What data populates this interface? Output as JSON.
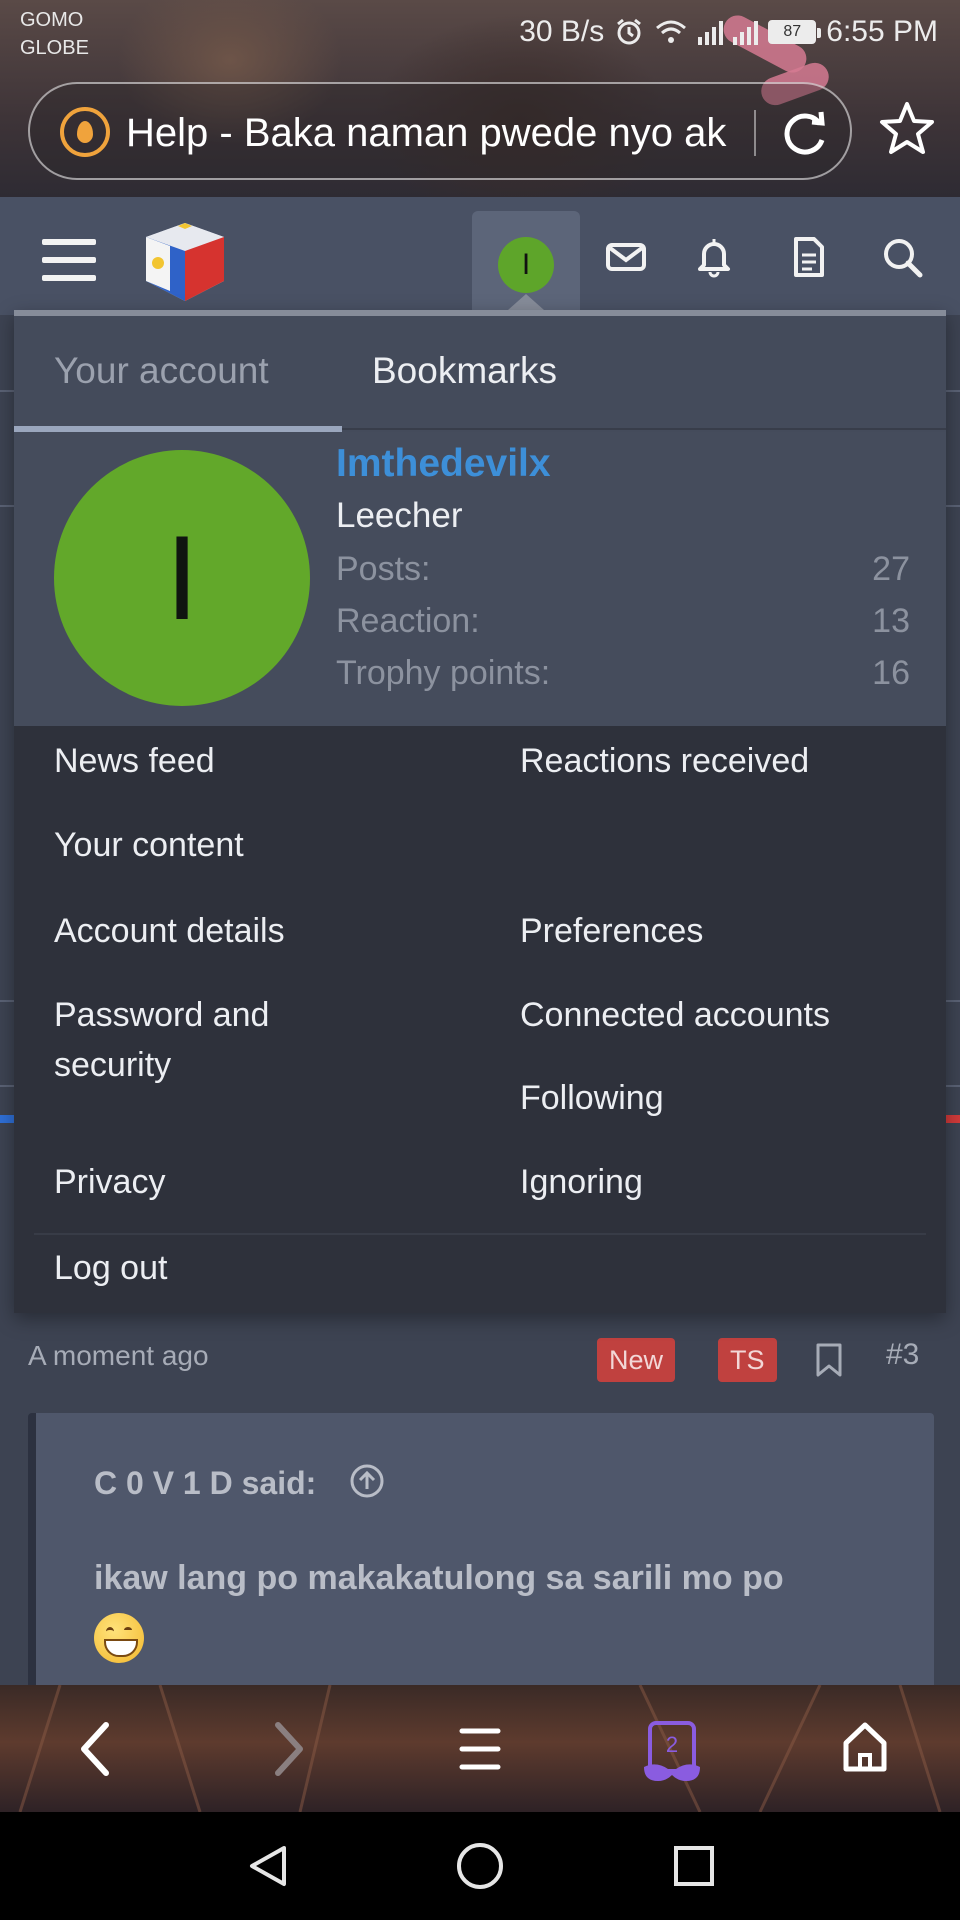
{
  "status_bar": {
    "carrier_line1": "GOMO",
    "carrier_line2": "GLOBE",
    "net_speed": "30 B/s",
    "battery": "87",
    "time": "6:55 PM"
  },
  "browser": {
    "url_text": "Help - Baka naman pwede nyo ak",
    "tab_count": "2"
  },
  "site_header": {
    "avatar_letter": "I"
  },
  "account_menu": {
    "tabs": [
      "Your account",
      "Bookmarks"
    ],
    "user": {
      "avatar_letter": "I",
      "name": "Imthedevilx",
      "title": "Leecher"
    },
    "stats": [
      {
        "label": "Posts:",
        "value": "27"
      },
      {
        "label": "Reaction:",
        "value": "13"
      },
      {
        "label": "Trophy points:",
        "value": "16"
      }
    ],
    "links": {
      "news_feed": "News feed",
      "reactions_received": "Reactions received",
      "your_content": "Your content",
      "account_details": "Account details",
      "preferences": "Preferences",
      "password_security": "Password and security",
      "connected_accounts": "Connected accounts",
      "following": "Following",
      "privacy": "Privacy",
      "ignoring": "Ignoring",
      "log_out": "Log out"
    }
  },
  "post": {
    "time": "A moment ago",
    "badge_new": "New",
    "badge_ts": "TS",
    "number": "#3",
    "quote_author": "C 0 V 1 D said:",
    "quote_text": "ikaw lang po makakatulong sa sarili mo po"
  },
  "colors": {
    "accent_link": "#3d8fd8",
    "avatar_green": "#62a82a",
    "badge_red": "#c0413f",
    "header_bg": "#495164",
    "menu_bg": "#2e313b"
  }
}
